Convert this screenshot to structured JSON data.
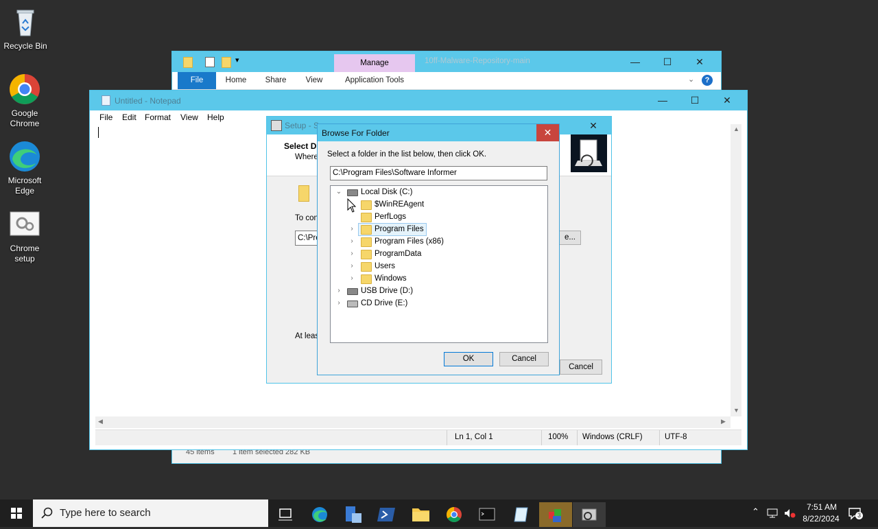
{
  "desktop": {
    "icons": [
      {
        "label": "Recycle Bin"
      },
      {
        "label": "Google Chrome"
      },
      {
        "label": "Microsoft Edge"
      },
      {
        "label": "Chrome setup"
      }
    ]
  },
  "explorer": {
    "title": "10ff-Malware-Repository-main",
    "manage_label": "Manage",
    "tabs": [
      "File",
      "Home",
      "Share",
      "View",
      "Application Tools"
    ],
    "status_items": "45 items",
    "status_selected": "1 item selected  282 KB"
  },
  "notepad": {
    "title": "Untitled - Notepad",
    "menu": [
      "File",
      "Edit",
      "Format",
      "View",
      "Help"
    ],
    "status": {
      "position": "Ln 1, Col 1",
      "zoom": "100%",
      "line_ending": "Windows (CRLF)",
      "encoding": "UTF-8"
    }
  },
  "setup": {
    "title": "Setup - S",
    "header_title": "Select D",
    "header_sub": "Where",
    "body_text": "To con",
    "path_value": "C:\\Prog",
    "browse_label": "e...",
    "footer_text": "At leas",
    "cancel_label": "Cancel"
  },
  "browse": {
    "title": "Browse For Folder",
    "instruction": "Select a folder in the list below, then click OK.",
    "path_value": "C:\\Program Files\\Software Informer",
    "tree": {
      "drive_c": "Local Disk (C:)",
      "folders": [
        "$WinREAgent",
        "PerfLogs",
        "Program Files",
        "Program Files (x86)",
        "ProgramData",
        "Users",
        "Windows"
      ],
      "drive_d": "USB Drive (D:)",
      "drive_e": "CD Drive (E:)"
    },
    "ok_label": "OK",
    "cancel_label": "Cancel"
  },
  "taskbar": {
    "search_placeholder": "Type here to search",
    "time": "7:51 AM",
    "date": "8/22/2024",
    "notification_count": "3"
  }
}
